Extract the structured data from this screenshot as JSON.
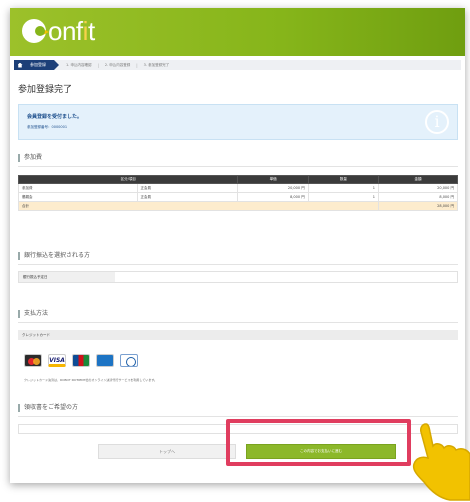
{
  "brand": {
    "logo_prefix": "c",
    "logo_main": "onf",
    "logo_accent": "i",
    "logo_end": "t"
  },
  "breadcrumb": {
    "current": "参加登録",
    "steps": [
      "1. 申込内容確認",
      "2. 申込内容登録",
      "3. 参加登録完了"
    ]
  },
  "page_title": "参加登録完了",
  "notice": {
    "title": "会員登録を受付ました。",
    "reference": "参加登録番号：0000001"
  },
  "sections": {
    "fee": "参加費",
    "bank": "銀行振込を選択される方",
    "payment": "支払方法",
    "steps": "領収書をご希望の方"
  },
  "fee_table": {
    "headers": [
      "区分/項目",
      "",
      "単価",
      "数量",
      "金額"
    ],
    "rows": [
      {
        "name": "参加費",
        "type": "正会員",
        "unit_price": "20,000 円",
        "qty": "1",
        "amount": "20,000 円"
      },
      {
        "name": "懇親会",
        "type": "正会員",
        "unit_price": "8,000 円",
        "qty": "1",
        "amount": "8,000 円"
      }
    ],
    "total_label": "合計",
    "total_amount": "28,000 円"
  },
  "bank": {
    "label": "銀行振込予定日"
  },
  "payment": {
    "method_label": "クレジットカード",
    "cards": [
      "mastercard-icon",
      "visa-icon",
      "jcb-icon",
      "amex-icon",
      "diners-icon"
    ],
    "note": "クレジットカード決済は、ROBOT PAYMENT社のオンライン決済代行サービスを利用しています。"
  },
  "buttons": {
    "top": "トップへ",
    "pay": "この内容でお支払いに進む"
  },
  "colors": {
    "header_green": "#86b51a",
    "nav_blue": "#1c3f78",
    "highlight": "#e03d5f",
    "pay_button": "#8cb82a",
    "pointer": "#f2c200"
  }
}
